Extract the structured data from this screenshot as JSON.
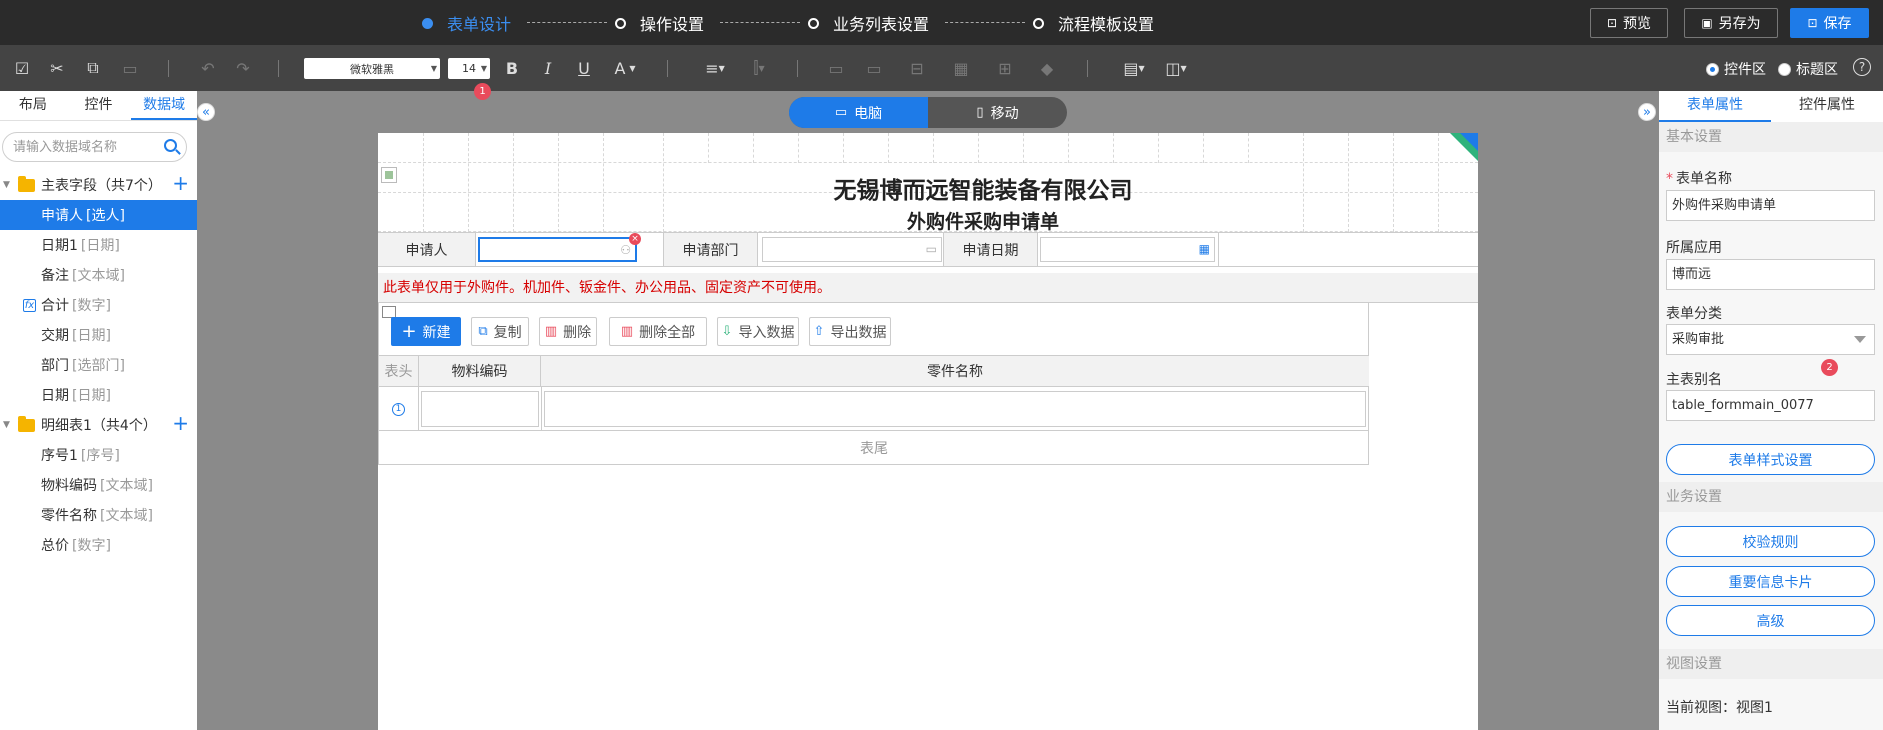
{
  "steps": [
    {
      "label": "表单设计",
      "active": true
    },
    {
      "label": "操作设置",
      "active": false
    },
    {
      "label": "业务列表设置",
      "active": false
    },
    {
      "label": "流程模板设置",
      "active": false
    }
  ],
  "top_actions": {
    "preview": "预览",
    "save_as": "另存为",
    "save": "保存"
  },
  "toolbar": {
    "font_family": "微软雅黑",
    "font_size": "14",
    "font_badge": "1",
    "bold": "B",
    "italic": "I",
    "underline": "U",
    "font_color": "A",
    "area_options": [
      "控件区",
      "标题区"
    ],
    "area_selected": "控件区",
    "help": "?"
  },
  "left_panel": {
    "tabs": [
      "布局",
      "控件",
      "数据域"
    ],
    "active_tab": "数据域",
    "search_placeholder": "请输入数据域名称",
    "groups": [
      {
        "label": "主表字段（共7个）",
        "items": [
          {
            "name": "申请人",
            "type": "[选人]",
            "selected": true
          },
          {
            "name": "日期1",
            "type": "[日期]"
          },
          {
            "name": "备注",
            "type": "[文本域]"
          },
          {
            "name": "合计",
            "type": "[数字]",
            "fx": true
          },
          {
            "name": "交期",
            "type": "[日期]"
          },
          {
            "name": "部门",
            "type": "[选部门]"
          },
          {
            "name": "日期",
            "type": "[日期]"
          }
        ]
      },
      {
        "label": "明细表1（共4个）",
        "items": [
          {
            "name": "序号1",
            "type": "[序号]"
          },
          {
            "name": "物料编码",
            "type": "[文本域]"
          },
          {
            "name": "零件名称",
            "type": "[文本域]"
          },
          {
            "name": "总价",
            "type": "[数字]"
          }
        ]
      }
    ]
  },
  "device_toggle": {
    "pc": "电脑",
    "mobile": "移动",
    "active": "pc"
  },
  "form": {
    "company": "无锡博而远智能装备有限公司",
    "title": "外购件采购申请单",
    "fields": [
      {
        "label": "申请人"
      },
      {
        "label": "申请部门"
      },
      {
        "label": "申请日期"
      }
    ],
    "notice": "此表单仅用于外购件。机加件、钣金件、办公用品、固定资产不可使用。",
    "detail": {
      "buttons": [
        "新建",
        "复制",
        "删除",
        "删除全部",
        "导入数据",
        "导出数据"
      ],
      "header_label": "表头",
      "columns": [
        "物料编码",
        "零件名称"
      ],
      "row_marker": "1",
      "footer": "表尾"
    }
  },
  "right_panel": {
    "tabs": [
      "表单属性",
      "控件属性"
    ],
    "active_tab": "表单属性",
    "section_basic": "基本设置",
    "form_name_label": "表单名称",
    "form_name": "外购件采购申请单",
    "app_label": "所属应用",
    "app": "博而远",
    "category_label": "表单分类",
    "category": "采购审批",
    "category_badge": "2",
    "alias_label": "主表别名",
    "alias": "table_formmain_0077",
    "style_button": "表单样式设置",
    "section_business": "业务设置",
    "business_buttons": [
      "校验规则",
      "重要信息卡片",
      "高级"
    ],
    "section_view": "视图设置",
    "current_view_label": "当前视图：",
    "current_view": "视图1"
  },
  "colors": {
    "accent": "#1e7be8",
    "topbar": "#2b2b2b",
    "toolbar": "#444444",
    "error": "#e94b5c",
    "notice": "#d60000"
  }
}
